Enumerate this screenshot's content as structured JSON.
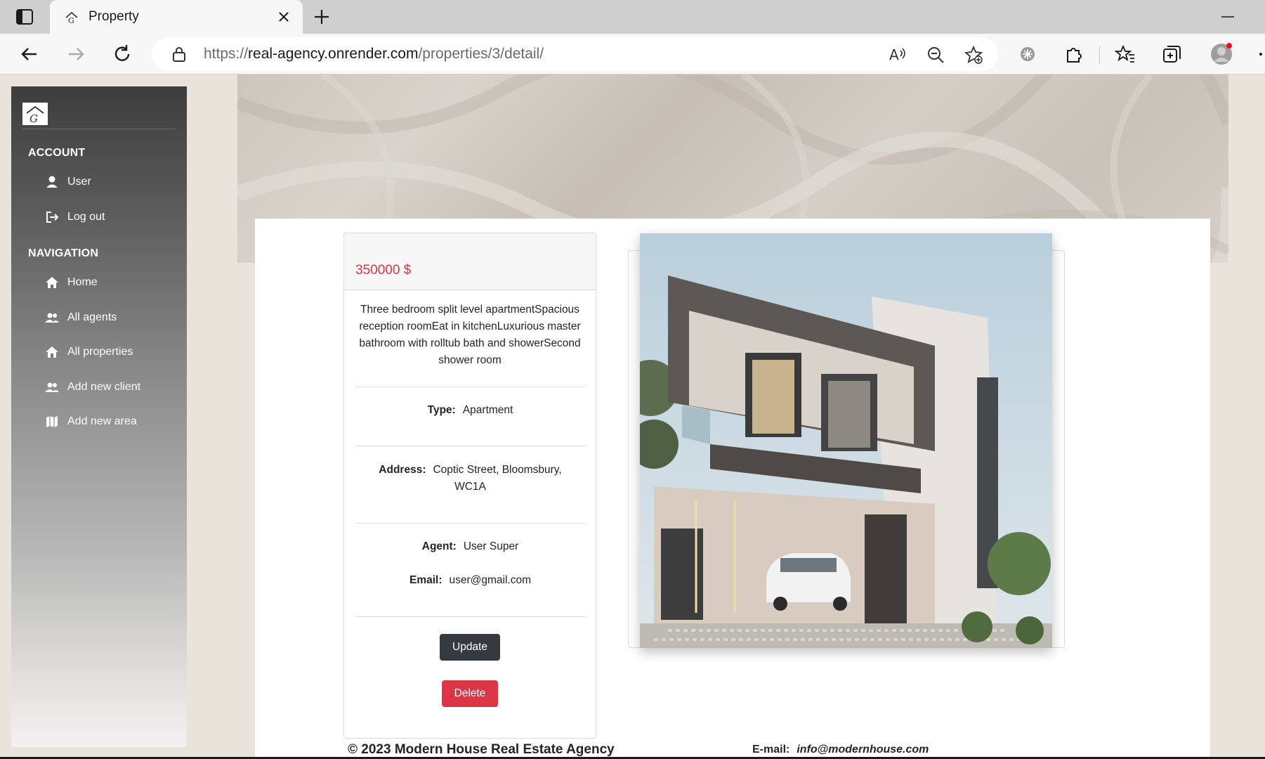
{
  "browser": {
    "tab_title": "Property",
    "url_scheme": "https://",
    "url_host": "real-agency.onrender.com",
    "url_path": "/properties/3/detail/"
  },
  "sidebar": {
    "account_heading": "ACCOUNT",
    "account_items": [
      {
        "label": "User",
        "icon": "user-icon"
      },
      {
        "label": "Log out",
        "icon": "logout-icon"
      }
    ],
    "navigation_heading": "NAVIGATION",
    "nav_items": [
      {
        "label": "Home",
        "icon": "home-icon"
      },
      {
        "label": "All agents",
        "icon": "users-icon"
      },
      {
        "label": "All properties",
        "icon": "house-icon"
      },
      {
        "label": "Add new client",
        "icon": "users-icon"
      },
      {
        "label": "Add new area",
        "icon": "map-icon"
      }
    ]
  },
  "property": {
    "price": "350000 $",
    "description": "Three bedroom split level apartmentSpacious reception roomEat in kitchenLuxurious master bathroom with rolltub bath and showerSecond shower room",
    "type_label": "Type:",
    "type_value": "Apartment",
    "address_label": "Address:",
    "address_value": "Coptic Street, Bloomsbury, WC1A",
    "agent_label": "Agent:",
    "agent_value": "User Super",
    "email_label": "Email:",
    "email_value": "user@gmail.com",
    "update_label": "Update",
    "delete_label": "Delete"
  },
  "footer": {
    "copyright": "© 2023 Modern House Real Estate Agency",
    "email_label": "E-mail:",
    "email_value": "info@modernhouse.com"
  },
  "colors": {
    "price": "#dc3545",
    "update_button": "#343a40",
    "delete_button": "#dc3545"
  }
}
